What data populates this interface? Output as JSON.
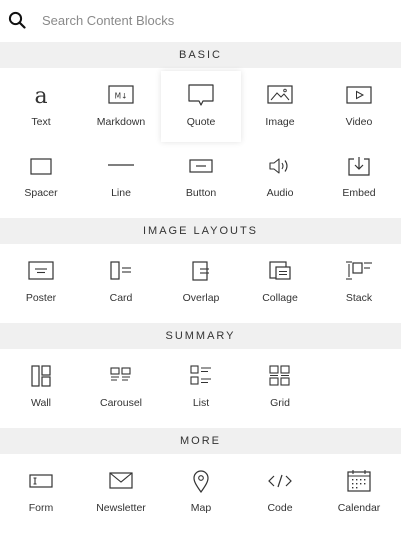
{
  "search": {
    "placeholder": "Search Content Blocks"
  },
  "sections": {
    "basic": {
      "title": "BASIC",
      "items": [
        "Text",
        "Markdown",
        "Quote",
        "Image",
        "Video",
        "Spacer",
        "Line",
        "Button",
        "Audio",
        "Embed"
      ]
    },
    "image_layouts": {
      "title": "IMAGE LAYOUTS",
      "items": [
        "Poster",
        "Card",
        "Overlap",
        "Collage",
        "Stack"
      ]
    },
    "summary": {
      "title": "SUMMARY",
      "items": [
        "Wall",
        "Carousel",
        "List",
        "Grid"
      ]
    },
    "more": {
      "title": "MORE",
      "items": [
        "Form",
        "Newsletter",
        "Map",
        "Code",
        "Calendar"
      ]
    }
  },
  "selected_item": "Quote",
  "colors": {
    "section_bg": "#f0f0f0",
    "icon_stroke": "#333333",
    "text": "#333333"
  }
}
